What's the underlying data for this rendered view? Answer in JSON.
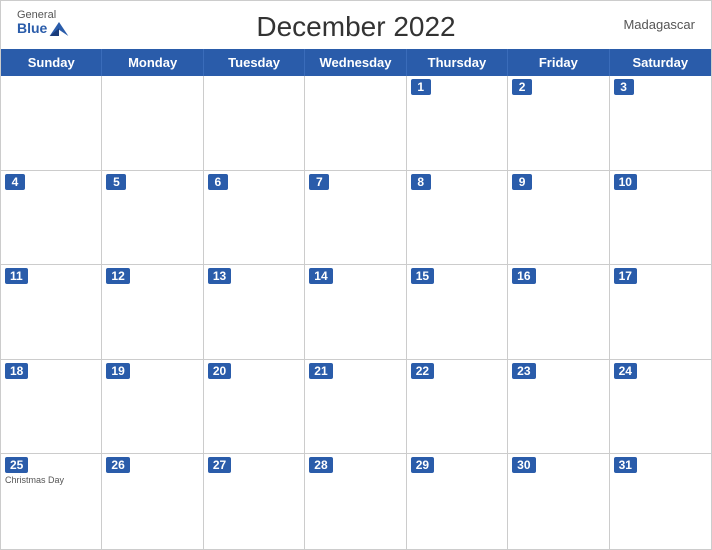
{
  "header": {
    "title": "December 2022",
    "country": "Madagascar",
    "logo": {
      "general": "General",
      "blue": "Blue"
    }
  },
  "weekdays": [
    "Sunday",
    "Monday",
    "Tuesday",
    "Wednesday",
    "Thursday",
    "Friday",
    "Saturday"
  ],
  "weeks": [
    [
      {
        "date": "",
        "empty": true
      },
      {
        "date": "",
        "empty": true
      },
      {
        "date": "",
        "empty": true
      },
      {
        "date": "",
        "empty": true
      },
      {
        "date": "1",
        "empty": false
      },
      {
        "date": "2",
        "empty": false
      },
      {
        "date": "3",
        "empty": false
      }
    ],
    [
      {
        "date": "4",
        "empty": false
      },
      {
        "date": "5",
        "empty": false
      },
      {
        "date": "6",
        "empty": false
      },
      {
        "date": "7",
        "empty": false
      },
      {
        "date": "8",
        "empty": false
      },
      {
        "date": "9",
        "empty": false
      },
      {
        "date": "10",
        "empty": false
      }
    ],
    [
      {
        "date": "11",
        "empty": false
      },
      {
        "date": "12",
        "empty": false
      },
      {
        "date": "13",
        "empty": false
      },
      {
        "date": "14",
        "empty": false
      },
      {
        "date": "15",
        "empty": false
      },
      {
        "date": "16",
        "empty": false
      },
      {
        "date": "17",
        "empty": false
      }
    ],
    [
      {
        "date": "18",
        "empty": false
      },
      {
        "date": "19",
        "empty": false
      },
      {
        "date": "20",
        "empty": false
      },
      {
        "date": "21",
        "empty": false
      },
      {
        "date": "22",
        "empty": false
      },
      {
        "date": "23",
        "empty": false
      },
      {
        "date": "24",
        "empty": false
      }
    ],
    [
      {
        "date": "25",
        "empty": false,
        "holiday": "Christmas Day"
      },
      {
        "date": "26",
        "empty": false
      },
      {
        "date": "27",
        "empty": false
      },
      {
        "date": "28",
        "empty": false
      },
      {
        "date": "29",
        "empty": false
      },
      {
        "date": "30",
        "empty": false
      },
      {
        "date": "31",
        "empty": false
      }
    ]
  ],
  "colors": {
    "blue": "#2a5caa",
    "text": "#333",
    "border": "#ccc"
  }
}
